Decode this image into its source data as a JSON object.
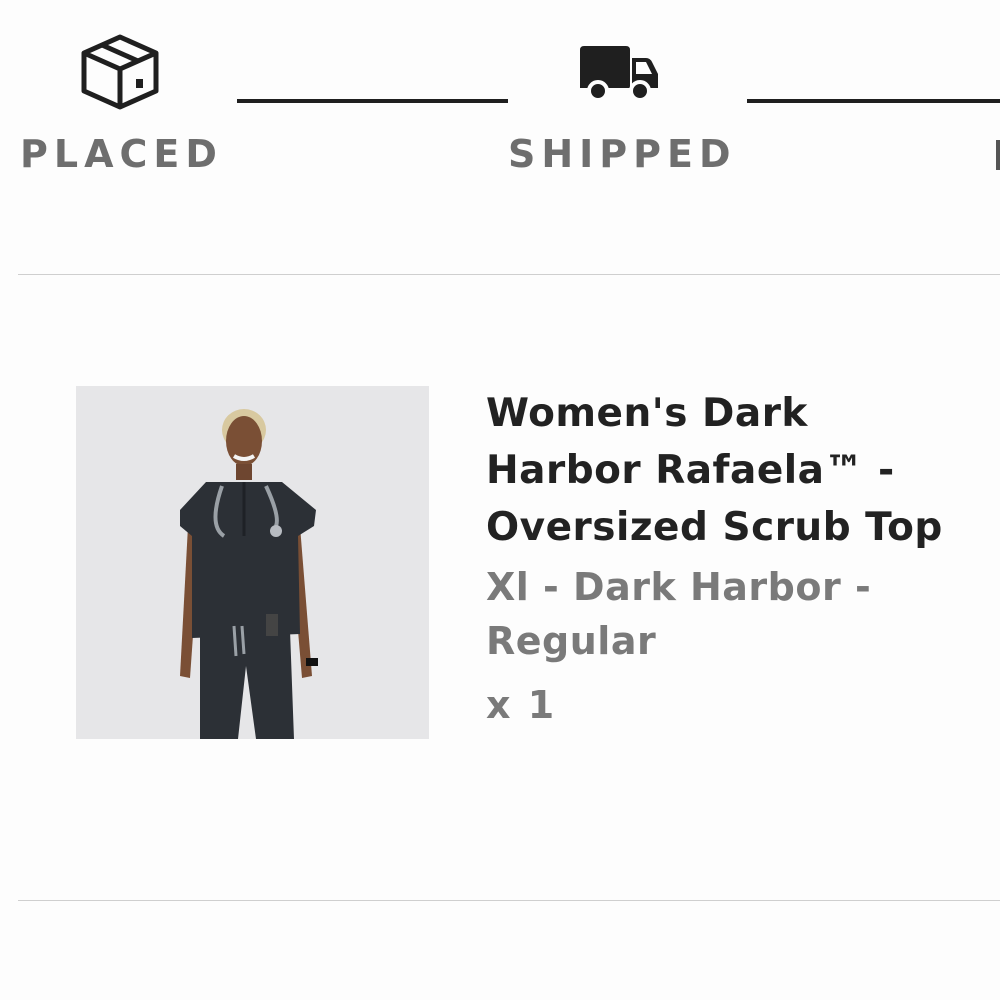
{
  "order_status": {
    "steps": [
      {
        "label": "PLACED",
        "icon": "box-icon"
      },
      {
        "label": "SHIPPED",
        "icon": "truck-icon"
      }
    ]
  },
  "line_item": {
    "title": "Women's Dark Harbor Rafaela™ - Oversized Scrub Top",
    "variant": "Xl - Dark Harbor - Regular",
    "quantity": "x 1",
    "image_icon": "product-photo"
  },
  "colors": {
    "icon": "#1f1f1f",
    "step_label": "#6e6e6e",
    "title": "#222222",
    "secondary_text": "#7a7a7a",
    "divider": "#cfcfcf"
  }
}
